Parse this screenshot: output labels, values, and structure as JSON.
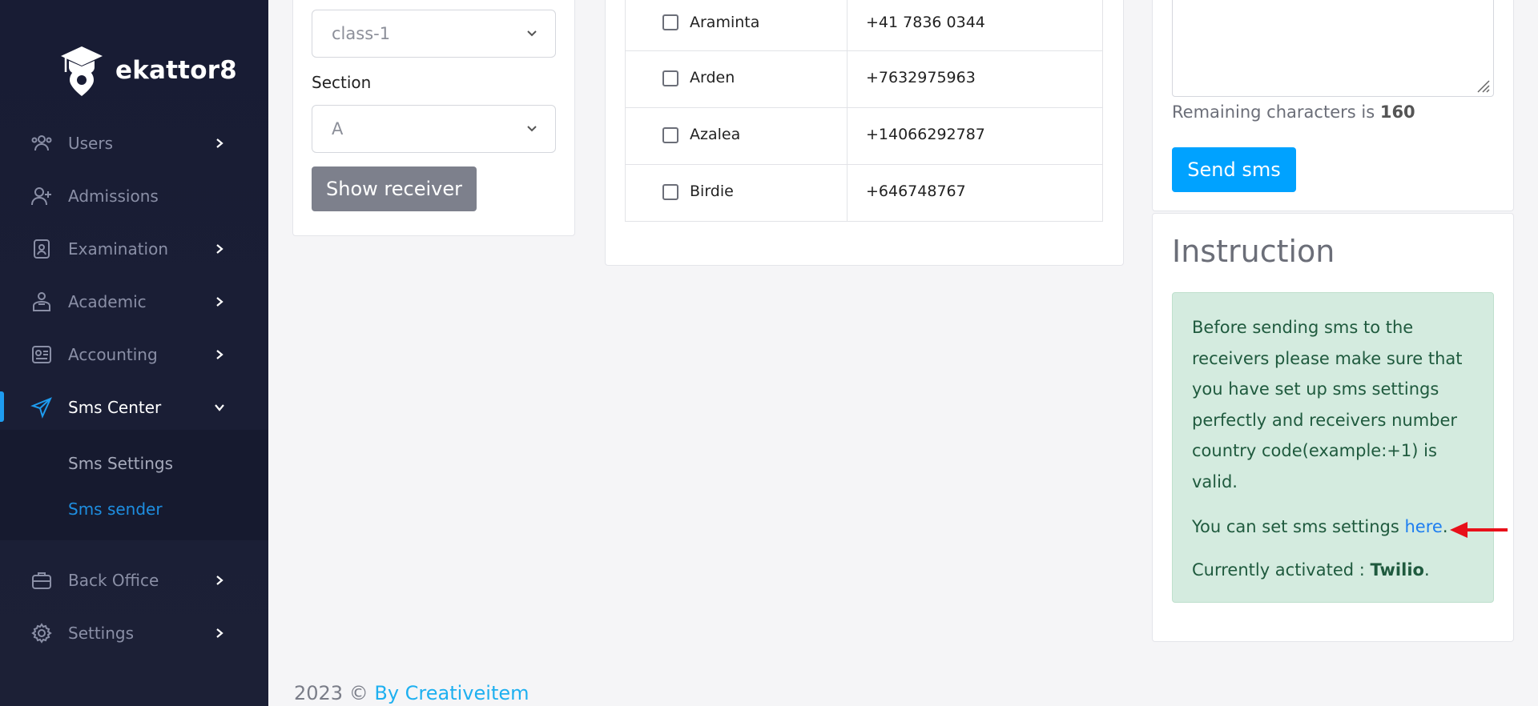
{
  "brand": {
    "name": "ekattor8"
  },
  "sidebar": {
    "items": [
      {
        "label": "Users",
        "icon": "users-icon",
        "has_chevron": true
      },
      {
        "label": "Admissions",
        "icon": "user-plus-icon",
        "has_chevron": false
      },
      {
        "label": "Examination",
        "icon": "exam-icon",
        "has_chevron": true
      },
      {
        "label": "Academic",
        "icon": "academic-icon",
        "has_chevron": true
      },
      {
        "label": "Accounting",
        "icon": "accounting-icon",
        "has_chevron": true
      },
      {
        "label": "Sms Center",
        "icon": "send-icon",
        "has_chevron": true,
        "active": true
      },
      {
        "label": "Back Office",
        "icon": "briefcase-icon",
        "has_chevron": true
      },
      {
        "label": "Settings",
        "icon": "gear-icon",
        "has_chevron": true
      }
    ],
    "sub_items": [
      {
        "label": "Sms Settings"
      },
      {
        "label": "Sms sender",
        "current": true
      }
    ],
    "accent_color": "#1e9cf0"
  },
  "filter": {
    "class_value": "class-1",
    "section_label": "Section",
    "section_value": "A",
    "show_receiver_label": "Show receiver"
  },
  "receivers": [
    {
      "name": "Araminta",
      "phone": "+41 7836 0344"
    },
    {
      "name": "Arden",
      "phone": "+7632975963"
    },
    {
      "name": "Azalea",
      "phone": "+14066292787"
    },
    {
      "name": "Birdie",
      "phone": "+646748767"
    }
  ],
  "sms": {
    "remaining_prefix": "Remaining characters is",
    "remaining_count": "160",
    "send_label": "Send sms",
    "send_color": "#00a2ff"
  },
  "instruction": {
    "title": "Instruction",
    "line1": "Before sending sms to the receivers please make sure that you have set up sms settings perfectly and receivers number country code(example:+1) is valid.",
    "line2_prefix": "You can set sms settings",
    "line2_link": "here",
    "line2_suffix": ".",
    "line3_prefix": "Currently activated :",
    "line3_value": "Twilio",
    "line3_suffix": "."
  },
  "footer": {
    "text": "2023 ©",
    "credit": "By Creativeitem"
  }
}
